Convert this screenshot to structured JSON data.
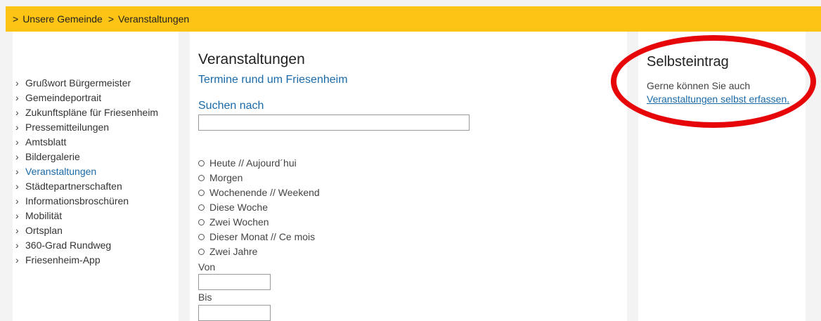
{
  "breadcrumb": {
    "separator": ">",
    "items": [
      "Unsere Gemeinde",
      "Veranstaltungen"
    ]
  },
  "sidebar": {
    "items": [
      {
        "label": "Grußwort Bürgermeister",
        "active": false
      },
      {
        "label": "Gemeindeportrait",
        "active": false
      },
      {
        "label": "Zukunftspläne für Friesenheim",
        "active": false
      },
      {
        "label": "Pressemitteilungen",
        "active": false
      },
      {
        "label": "Amtsblatt",
        "active": false
      },
      {
        "label": "Bildergalerie",
        "active": false
      },
      {
        "label": "Veranstaltungen",
        "active": true
      },
      {
        "label": "Städtepartnerschaften",
        "active": false
      },
      {
        "label": "Informationsbroschüren",
        "active": false
      },
      {
        "label": "Mobilität",
        "active": false
      },
      {
        "label": "Ortsplan",
        "active": false
      },
      {
        "label": "360-Grad Rundweg",
        "active": false
      },
      {
        "label": "Friesenheim-App",
        "active": false
      }
    ]
  },
  "main": {
    "title": "Veranstaltungen",
    "subtitle": "Termine rund um Friesenheim",
    "search_label": "Suchen nach",
    "search_value": "",
    "filters": [
      "Heute // Aujourd´hui",
      "Morgen",
      "Wochenende // Weekend",
      "Diese Woche",
      "Zwei Wochen",
      "Dieser Monat // Ce mois",
      "Zwei Jahre"
    ],
    "from_label": "Von",
    "from_value": "",
    "to_label": "Bis",
    "to_value": ""
  },
  "aside": {
    "title": "Selbsteintrag",
    "text": "Gerne können Sie auch",
    "link": "Veranstaltungen selbst erfassen",
    "link_suffix": "."
  },
  "colors": {
    "accent_bar": "#fdc315",
    "link": "#1a6aa8",
    "highlight_ellipse": "#e6060a"
  }
}
